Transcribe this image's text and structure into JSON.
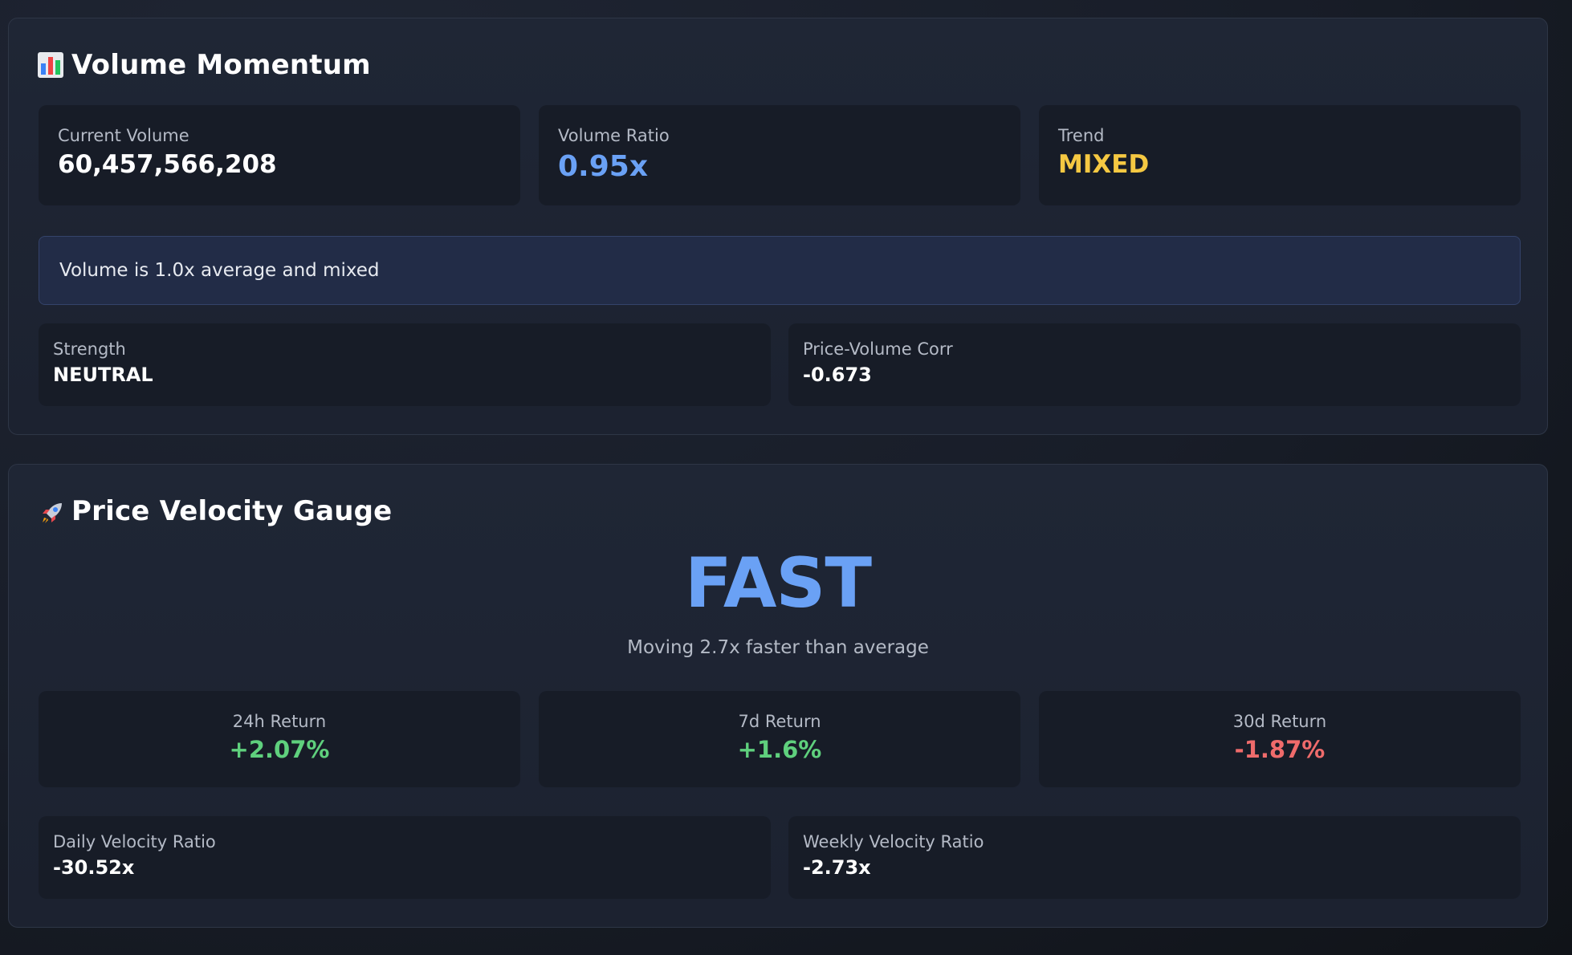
{
  "volume_momentum": {
    "icon": "bar-chart-icon",
    "title": "Volume Momentum",
    "current_volume": {
      "label": "Current Volume",
      "value": "60,457,566,208"
    },
    "volume_ratio": {
      "label": "Volume Ratio",
      "value": "0.95x"
    },
    "trend": {
      "label": "Trend",
      "value": "MIXED"
    },
    "summary": "Volume is 1.0x average and mixed",
    "strength": {
      "label": "Strength",
      "value": "NEUTRAL"
    },
    "price_volume_corr": {
      "label": "Price-Volume Corr",
      "value": "-0.673"
    }
  },
  "price_velocity": {
    "icon": "rocket-icon",
    "title": "Price Velocity Gauge",
    "gauge_value": "FAST",
    "gauge_description": "Moving 2.7x faster than average",
    "returns": [
      {
        "label": "24h Return",
        "value": "+2.07%",
        "direction": "positive"
      },
      {
        "label": "7d Return",
        "value": "+1.6%",
        "direction": "positive"
      },
      {
        "label": "30d Return",
        "value": "-1.87%",
        "direction": "negative"
      }
    ],
    "daily_velocity_ratio": {
      "label": "Daily Velocity Ratio",
      "value": "-30.52x"
    },
    "weekly_velocity_ratio": {
      "label": "Weekly Velocity Ratio",
      "value": "-2.73x"
    }
  },
  "colors": {
    "accent_blue": "#6aa1f5",
    "trend_yellow": "#f5c842",
    "positive_green": "#5fd07d",
    "negative_red": "#ef6b6b"
  }
}
